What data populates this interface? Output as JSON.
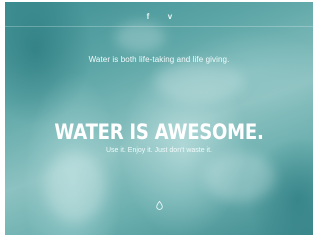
{
  "header": {
    "social": [
      {
        "icon": "facebook-icon",
        "glyph": "f"
      },
      {
        "icon": "vimeo-icon",
        "glyph": "v"
      }
    ]
  },
  "intro": {
    "tagline": "Water is both life-taking and life giving."
  },
  "hero": {
    "headline": "WATER IS AWESOME.",
    "subline": "Use it. Enjoy it. Just don't waste it."
  },
  "footer": {
    "scroll_icon": "water-drop-icon"
  },
  "colors": {
    "water_dark": "#3e8f93",
    "water_light": "#8cc2c1",
    "text": "#ffffff"
  }
}
